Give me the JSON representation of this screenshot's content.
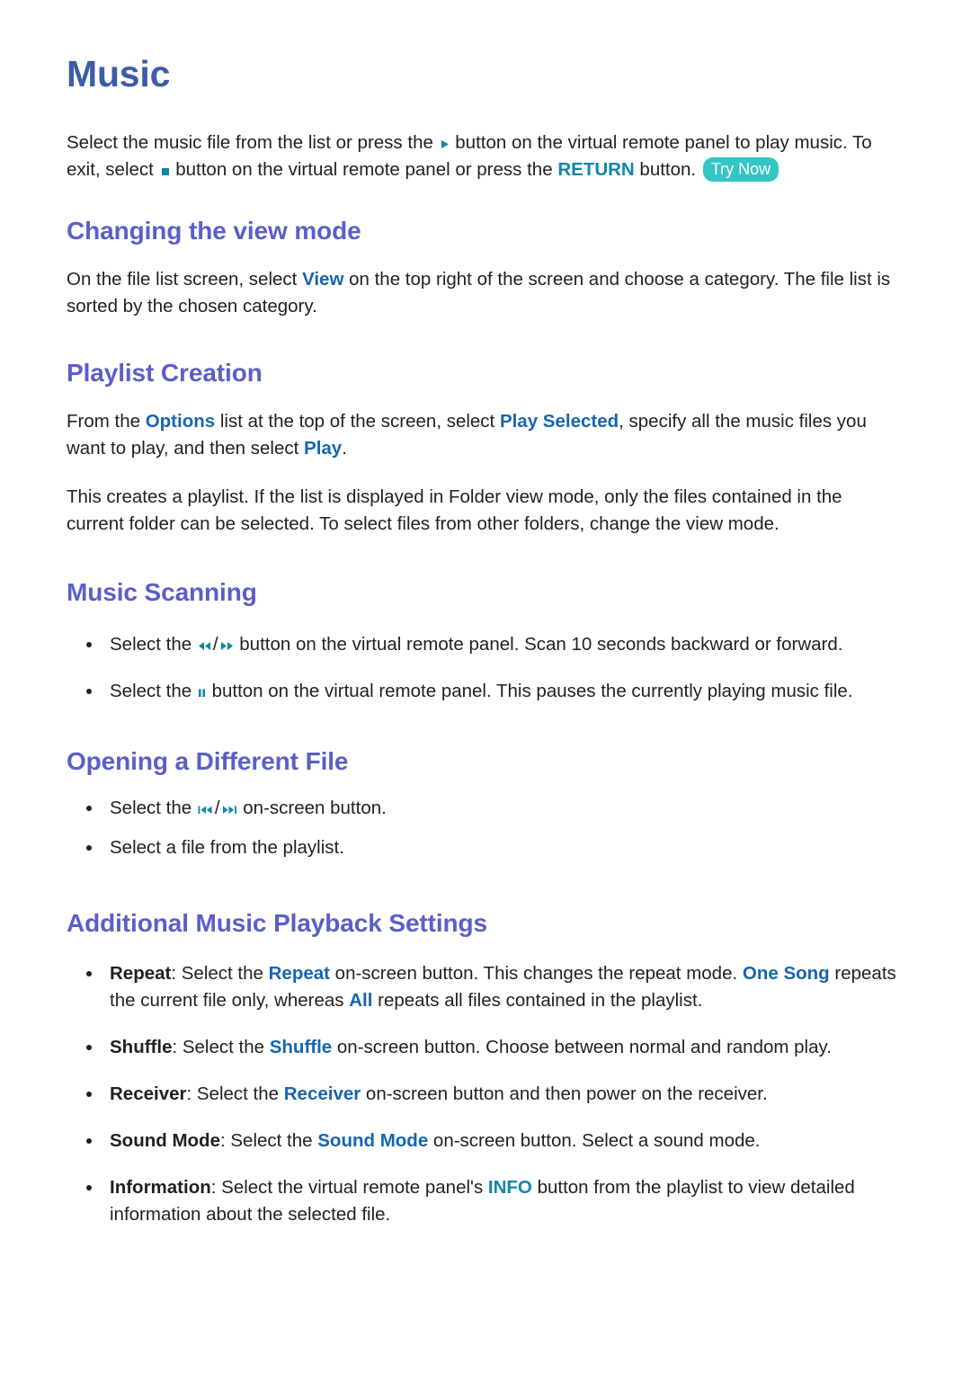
{
  "document": {
    "title": "Music"
  },
  "intro": {
    "part1": "Select the music file from the list or press the ",
    "icon_play": "play-icon",
    "part2": " button on the virtual remote panel to play music. To exit, select ",
    "icon_stop": "stop-icon",
    "part3": " button on the virtual remote panel or press the ",
    "kw_return": "RETURN",
    "part4": " button. ",
    "try_now": "Try Now"
  },
  "sections": [
    {
      "id": "changing-the-view-mode",
      "heading": "Changing the view mode",
      "paragraph_part1": "On the file list screen, select ",
      "kw_view": "View",
      "paragraph_part2": " on the top right of the screen and choose a category. The file list is sorted by the chosen category."
    },
    {
      "id": "playlist-creation",
      "heading": "Playlist Creation",
      "p1_part1": "From the ",
      "p1_kw_options": "Options",
      "p1_part2": " list at the top of the screen, select ",
      "p1_kw_play_selected": "Play Selected",
      "p1_part3": ", specify all the music files you want to play, and then select ",
      "p1_kw_play": "Play",
      "p1_part4": ".",
      "p2": "This creates a playlist. If the list is displayed in Folder view mode, only the files contained in the current folder can be selected. To select files from other folders, change the view mode."
    },
    {
      "id": "music-scanning",
      "heading": "Music Scanning",
      "bullets": [
        {
          "part1": "Select the ",
          "icon_a": "rewind-icon",
          "separator": "/",
          "icon_b": "fast-forward-icon",
          "part2": " button on the virtual remote panel. Scan 10 seconds backward or forward."
        },
        {
          "part1": "Select the ",
          "icon_a": "pause-icon",
          "part2": " button on the virtual remote panel. This pauses the currently playing music file."
        }
      ]
    },
    {
      "id": "opening-a-different-file",
      "heading": "Opening a Different File",
      "bullets": [
        {
          "part1": "Select the ",
          "icon_a": "skip-previous-icon",
          "separator": "/",
          "icon_b": "skip-next-icon",
          "part2": " on-screen button."
        },
        {
          "text": "Select a file from the playlist."
        }
      ]
    },
    {
      "id": "additional-music-playback-settings",
      "heading": "Additional Music Playback Settings",
      "bullets": [
        {
          "label": "Repeat",
          "part1": ": Select the ",
          "kw1": "Repeat",
          "part2": " on-screen button. This changes the repeat mode. ",
          "kw2": "One Song",
          "part3": " repeats the current file only, whereas ",
          "kw3": "All",
          "part4": " repeats all files contained in the playlist."
        },
        {
          "label": "Shuffle",
          "part1": ": Select the ",
          "kw1": "Shuffle",
          "part2": " on-screen button. Choose between normal and random play."
        },
        {
          "label": "Receiver",
          "part1": ": Select the ",
          "kw1": "Receiver",
          "part2": " on-screen button and then power on the receiver."
        },
        {
          "label": "Sound Mode",
          "part1": ": Select the ",
          "kw1": "Sound Mode",
          "part2": " on-screen button. Select a sound mode."
        },
        {
          "label": "Information",
          "part1": ": Select the virtual remote panel's ",
          "kw1": "INFO",
          "part2": " button from the playlist to view detailed information about the selected file."
        }
      ]
    }
  ],
  "colors": {
    "page_title": "#3b5ca8",
    "section_title": "#5a5fc8",
    "keyword_blue": "#1665b0",
    "keyword_teal": "#1187a8",
    "try_now_bg": "#32c6c6",
    "body_text": "#231f20"
  }
}
